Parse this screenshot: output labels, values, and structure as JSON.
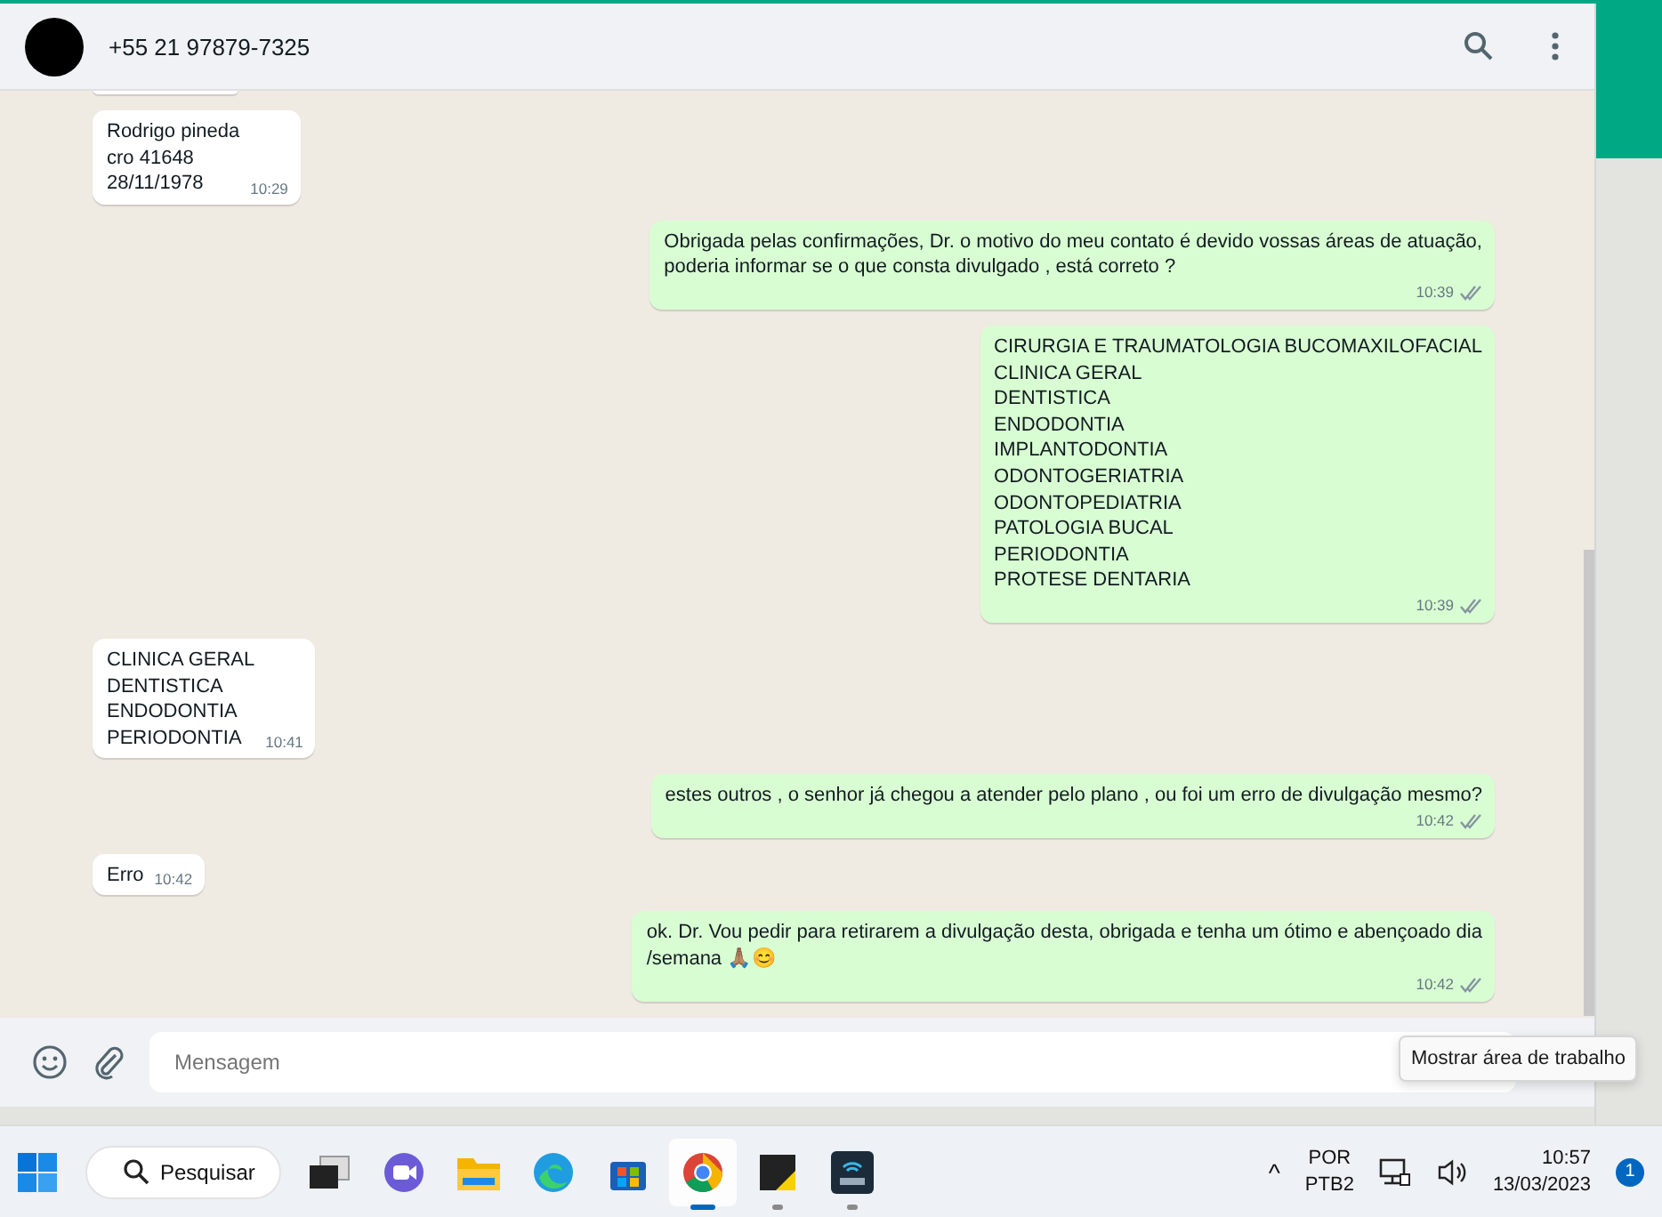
{
  "chat": {
    "contact_name": "+55 21 97879-7325"
  },
  "messages": [
    {
      "kind": "in"
    },
    {
      "kind": "in",
      "lines": [
        "Rodrigo pineda",
        "cro 41648",
        "28/11/1978"
      ],
      "time": "10:29"
    },
    {
      "kind": "out",
      "lines": [
        "Obrigada pelas confirmações, Dr. o motivo do meu contato é devido vossas áreas de atuação,",
        "poderia informar se o que consta divulgado , está correto ?"
      ],
      "time": "10:39",
      "read": false
    },
    {
      "kind": "out",
      "lines": [
        "CIRURGIA E TRAUMATOLOGIA BUCOMAXILOFACIAL",
        "CLINICA GERAL",
        "DENTISTICA",
        "ENDODONTIA",
        "IMPLANTODONTIA",
        "ODONTOGERIATRIA",
        "ODONTOPEDIATRIA",
        "PATOLOGIA BUCAL",
        "PERIODONTIA",
        "PROTESE DENTARIA"
      ],
      "time": "10:39",
      "read": false
    },
    {
      "kind": "in",
      "lines": [
        "CLINICA GERAL",
        "DENTISTICA",
        "ENDODONTIA",
        "PERIODONTIA"
      ],
      "time": "10:41"
    },
    {
      "kind": "out",
      "lines": [
        "estes outros , o senhor já chegou a atender pelo plano , ou foi um erro de divulgação mesmo?"
      ],
      "time": "10:42",
      "read": false
    },
    {
      "kind": "in",
      "lines": [
        "Erro"
      ],
      "time": "10:42"
    },
    {
      "kind": "out",
      "lines": [
        "ok. Dr. Vou pedir para retirarem a divulgação desta, obrigada e tenha um ótimo e abençoado dia",
        "/semana 🙏🏽😊"
      ],
      "time": "10:42",
      "read": false
    }
  ],
  "composer": {
    "placeholder": "Mensagem"
  },
  "tooltip": "Mostrar área de trabalho",
  "taskbar": {
    "search_label": "Pesquisar",
    "apps": [
      {
        "kind": "taskview",
        "running": false,
        "selected": false
      },
      {
        "kind": "meet",
        "running": false,
        "selected": false
      },
      {
        "kind": "folder",
        "running": false,
        "selected": false
      },
      {
        "kind": "edge",
        "running": false,
        "selected": false
      },
      {
        "kind": "store",
        "running": false,
        "selected": false
      },
      {
        "kind": "chrome",
        "running": true,
        "selected": true
      },
      {
        "kind": "notes",
        "running": true,
        "selected": false
      },
      {
        "kind": "threecx",
        "running": true,
        "selected": false
      }
    ],
    "tray_caret": "^",
    "language": "POR",
    "layout": "PTB2",
    "time": "10:57",
    "date": "13/03/2023",
    "notification_count": "1"
  }
}
